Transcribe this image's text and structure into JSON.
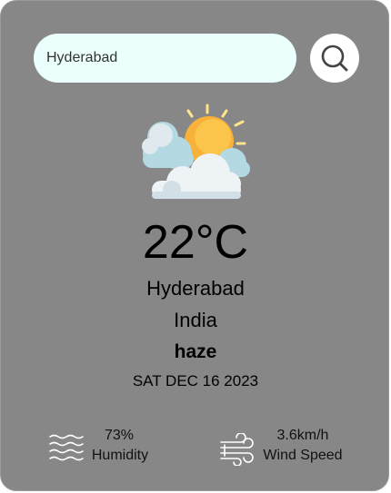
{
  "search": {
    "value": "Hyderabad",
    "button_icon": "search-icon"
  },
  "weather": {
    "icon": "cloudy-sun-icon",
    "temperature": "22°C",
    "city": "Hyderabad",
    "country": "India",
    "condition": "haze",
    "date": "SAT DEC 16 2023"
  },
  "stats": {
    "humidity": {
      "icon": "waves-icon",
      "value": "73%",
      "label": "Humidity"
    },
    "wind": {
      "icon": "wind-icon",
      "value": "3.6km/h",
      "label": "Wind Speed"
    }
  },
  "colors": {
    "card_background": "#878787",
    "search_background": "#ebfffc",
    "sun": "#f8b23a",
    "cloud": "#eef3f6",
    "cloud_shade": "#b5d9e2"
  }
}
